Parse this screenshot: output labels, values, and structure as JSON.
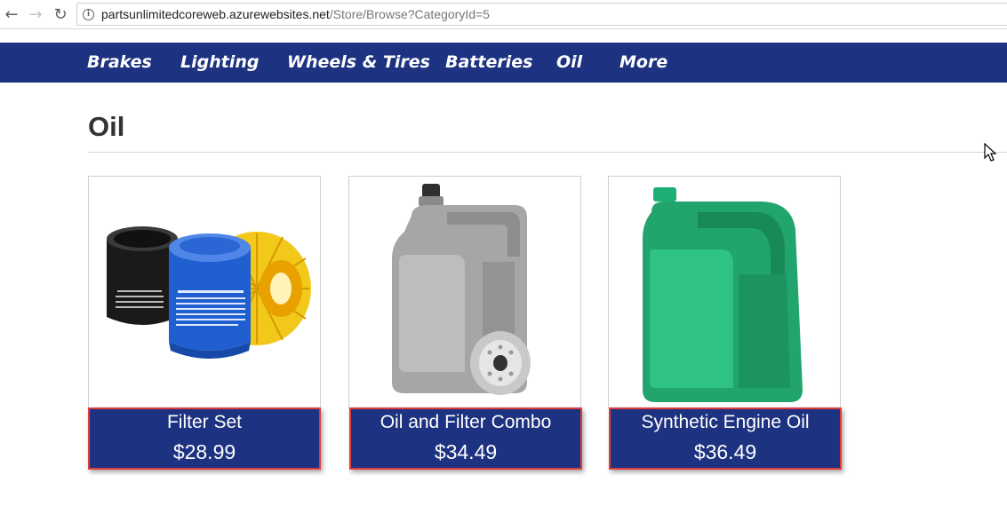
{
  "browser": {
    "back_icon": "arrow-left-icon",
    "forward_icon": "arrow-right-icon",
    "reload_icon": "reload-icon",
    "info_icon": "info-icon",
    "url_host": "partsunlimitedcoreweb.azurewebsites.net",
    "url_path": "/Store/Browse?CategoryId=5"
  },
  "nav": {
    "items": [
      {
        "label": "Brakes"
      },
      {
        "label": "Lighting"
      },
      {
        "label": "Wheels & Tires"
      },
      {
        "label": "Batteries"
      },
      {
        "label": "Oil"
      },
      {
        "label": "More"
      }
    ]
  },
  "page": {
    "title": "Oil"
  },
  "products": [
    {
      "name": "Filter Set",
      "price": "$28.99",
      "image": "oil-filter-set-image"
    },
    {
      "name": "Oil and Filter Combo",
      "price": "$34.49",
      "image": "oil-and-filter-combo-image"
    },
    {
      "name": "Synthetic Engine Oil",
      "price": "$36.49",
      "image": "synthetic-engine-oil-image"
    }
  ],
  "colors": {
    "nav_background": "#1d3280",
    "caption_background": "#1d3280",
    "caption_highlight_border": "#e23b3b"
  }
}
